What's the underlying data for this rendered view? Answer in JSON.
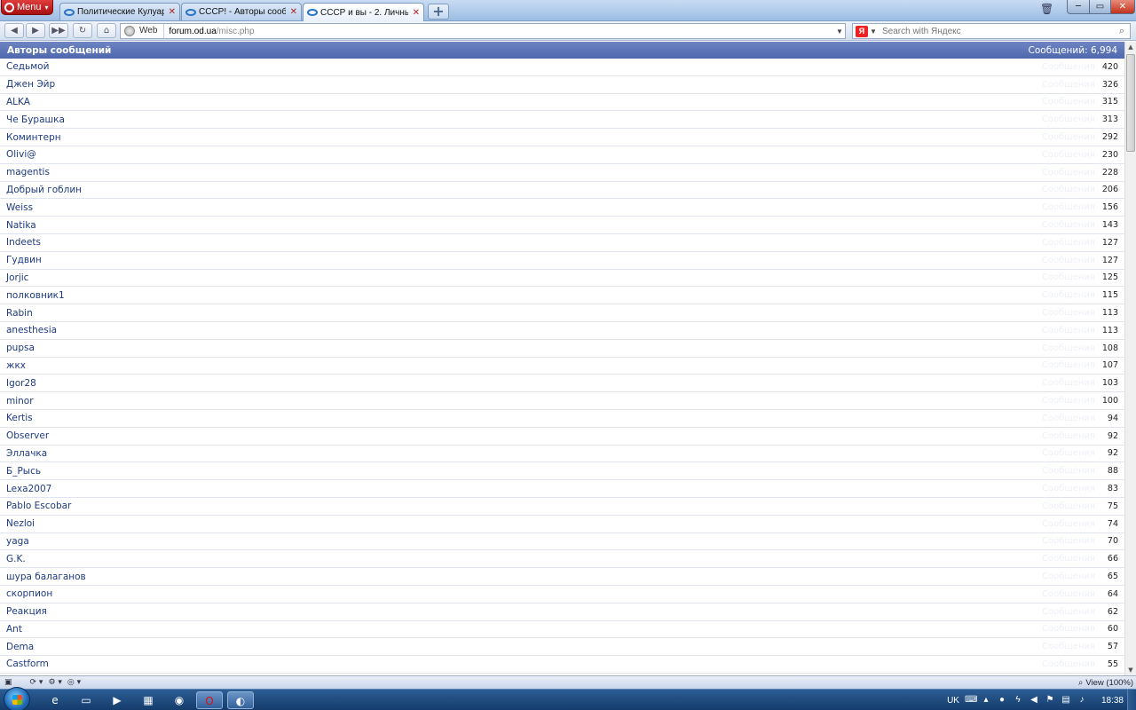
{
  "browser": {
    "menu_label": "Menu",
    "tabs": [
      {
        "label": "Политические Кулуар...",
        "active": false
      },
      {
        "label": "СССР! - Авторы сооб...",
        "active": false
      },
      {
        "label": "СССР и вы - 2. Личны...",
        "active": true
      }
    ],
    "address": {
      "tag": "Web",
      "host": "forum.od.ua",
      "path": "/misc.php"
    },
    "search_placeholder": "Search with Яндекс",
    "search_engine_badge": "Я"
  },
  "page": {
    "title": "Авторы сообщений",
    "total_label": "Сообщений: 6,994",
    "row_hint": "Сообщения",
    "authors": [
      {
        "name": "Седьмой",
        "count": "420"
      },
      {
        "name": "Джен Эйр",
        "count": "326"
      },
      {
        "name": "ALKA",
        "count": "315"
      },
      {
        "name": "Че Бурашка",
        "count": "313"
      },
      {
        "name": "Коминтерн",
        "count": "292"
      },
      {
        "name": "Olivi@",
        "count": "230"
      },
      {
        "name": "magentis",
        "count": "228"
      },
      {
        "name": "Добрый гоблин",
        "count": "206"
      },
      {
        "name": "Weiss",
        "count": "156"
      },
      {
        "name": "Natika",
        "count": "143"
      },
      {
        "name": "Indeets",
        "count": "127"
      },
      {
        "name": "Гудвин",
        "count": "127"
      },
      {
        "name": "Jorjic",
        "count": "125"
      },
      {
        "name": "полковник1",
        "count": "115"
      },
      {
        "name": "Rabin",
        "count": "113"
      },
      {
        "name": "anesthesia",
        "count": "113"
      },
      {
        "name": "pupsa",
        "count": "108"
      },
      {
        "name": "жкх",
        "count": "107"
      },
      {
        "name": "Igor28",
        "count": "103"
      },
      {
        "name": "minor",
        "count": "100"
      },
      {
        "name": "Kertis",
        "count": "94"
      },
      {
        "name": "Observer",
        "count": "92"
      },
      {
        "name": "Эллачка",
        "count": "92"
      },
      {
        "name": "Б_Рысь",
        "count": "88"
      },
      {
        "name": "Lexa2007",
        "count": "83"
      },
      {
        "name": "Pablo Escobar",
        "count": "75"
      },
      {
        "name": "Nezloi",
        "count": "74"
      },
      {
        "name": "yaga",
        "count": "70"
      },
      {
        "name": "G.K.",
        "count": "66"
      },
      {
        "name": "шура балаганов",
        "count": "65"
      },
      {
        "name": "скорпион",
        "count": "64"
      },
      {
        "name": "Реакция",
        "count": "62"
      },
      {
        "name": "Ant",
        "count": "60"
      },
      {
        "name": "Dema",
        "count": "57"
      },
      {
        "name": "Castform",
        "count": "55"
      }
    ]
  },
  "statusbar": {
    "zoom_label": "View (100%)"
  },
  "taskbar": {
    "lang": "UK",
    "clock": "18:38"
  },
  "colors": {
    "header_bg": "#5a71b5",
    "link": "#1e3a80",
    "tab_close": "#b02020"
  }
}
